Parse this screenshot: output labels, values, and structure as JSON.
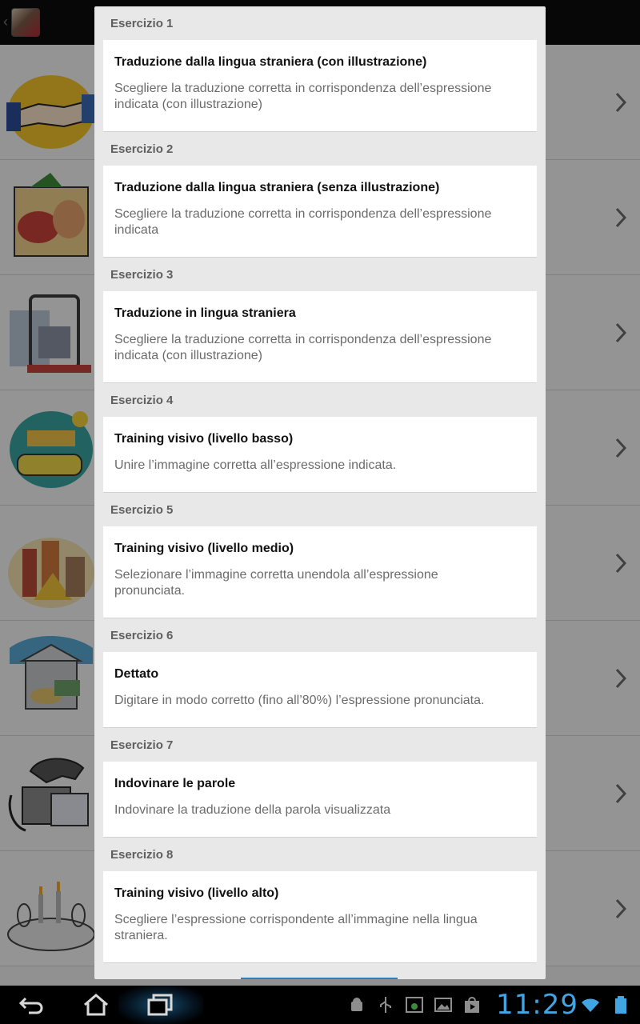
{
  "dialog": {
    "sections": [
      {
        "header": "Esercizio 1",
        "title": "Traduzione dalla lingua straniera (con illustrazione)",
        "desc_line1": "Scegliere la traduzione corretta in corrispondenza dell’espressione",
        "desc_line2": "indicata (con illustrazione)"
      },
      {
        "header": "Esercizio 2",
        "title": "Traduzione dalla lingua straniera (senza illustrazione)",
        "desc_line1": "Scegliere la traduzione corretta in corrispondenza dell’espressione",
        "desc_line2": "indicata"
      },
      {
        "header": "Esercizio 3",
        "title": "Traduzione in lingua straniera",
        "desc_line1": "Scegliere la traduzione corretta in corrispondenza dell’espressione",
        "desc_line2": "indicata (con illustrazione)"
      },
      {
        "header": "Esercizio 4",
        "title": "Training visivo (livello basso)",
        "desc_line1": "Unire l’immagine corretta all’espressione indicata.",
        "desc_line2": ""
      },
      {
        "header": "Esercizio 5",
        "title": "Training visivo (livello medio)",
        "desc_line1": "Selezionare l’immagine corretta unendola all’espressione",
        "desc_line2": "pronunciata."
      },
      {
        "header": "Esercizio 6",
        "title": "Dettato",
        "desc_line1": "Digitare in modo corretto (fino all’80%) l’espressione pronunciata.",
        "desc_line2": ""
      },
      {
        "header": "Esercizio 7",
        "title": "Indovinare le parole",
        "desc_line1": "Indovinare la traduzione della parola visualizzata",
        "desc_line2": ""
      },
      {
        "header": "Esercizio 8",
        "title": "Training visivo (livello alto)",
        "desc_line1": "Scegliere l’espressione corrispondente all’immagine nella lingua",
        "desc_line2": "straniera."
      }
    ]
  },
  "background": {
    "rows": [
      {
        "icon": "handshake-icon"
      },
      {
        "icon": "food-icon"
      },
      {
        "icon": "luggage-icon"
      },
      {
        "icon": "train-icon"
      },
      {
        "icon": "city-icon"
      },
      {
        "icon": "bank-icon"
      },
      {
        "icon": "telephone-icon"
      },
      {
        "icon": "dinner-icon"
      }
    ]
  },
  "statusbar": {
    "time": "11:29",
    "accent": "#41a5e3"
  }
}
